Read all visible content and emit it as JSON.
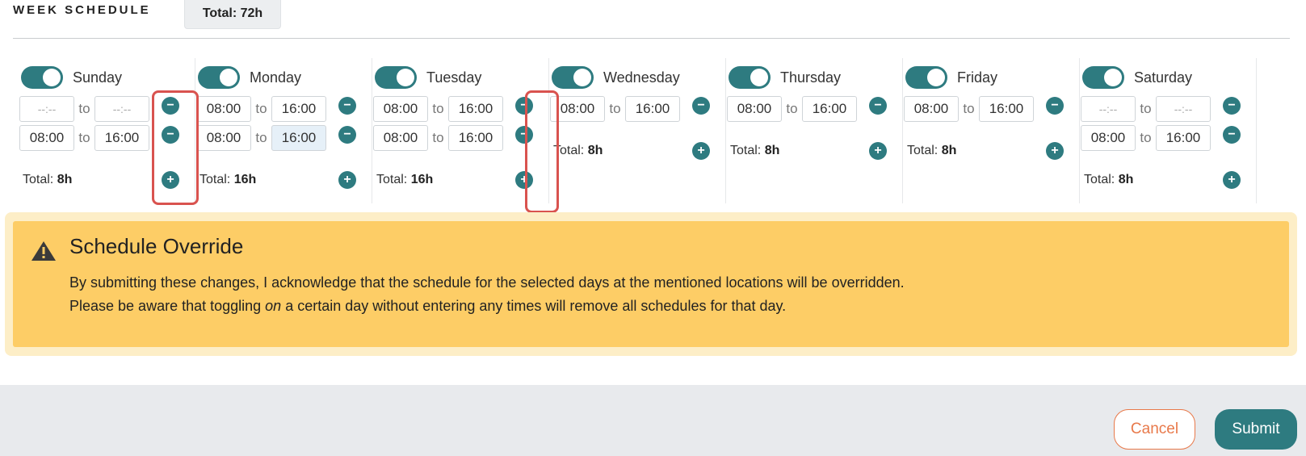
{
  "header": {
    "title": "WEEK SCHEDULE",
    "total": "Total: 72h"
  },
  "days": [
    {
      "name": "Sunday",
      "enabled": true,
      "slots": [
        {
          "from": "--:--",
          "to": "--:--"
        },
        {
          "from": "08:00",
          "to": "16:00"
        }
      ],
      "total_label": "Total:",
      "total_value": "8h"
    },
    {
      "name": "Monday",
      "enabled": true,
      "slots": [
        {
          "from": "08:00",
          "to": "16:00"
        },
        {
          "from": "08:00",
          "to": "16:00"
        }
      ],
      "total_label": "Total:",
      "total_value": "16h"
    },
    {
      "name": "Tuesday",
      "enabled": true,
      "slots": [
        {
          "from": "08:00",
          "to": "16:00"
        },
        {
          "from": "08:00",
          "to": "16:00"
        }
      ],
      "total_label": "Total:",
      "total_value": "16h"
    },
    {
      "name": "Wednesday",
      "enabled": true,
      "slots": [
        {
          "from": "08:00",
          "to": "16:00"
        }
      ],
      "total_label": "Total:",
      "total_value": "8h"
    },
    {
      "name": "Thursday",
      "enabled": true,
      "slots": [
        {
          "from": "08:00",
          "to": "16:00"
        }
      ],
      "total_label": "Total:",
      "total_value": "8h"
    },
    {
      "name": "Friday",
      "enabled": true,
      "slots": [
        {
          "from": "08:00",
          "to": "16:00"
        }
      ],
      "total_label": "Total:",
      "total_value": "8h"
    },
    {
      "name": "Saturday",
      "enabled": true,
      "slots": [
        {
          "from": "--:--",
          "to": "--:--"
        },
        {
          "from": "08:00",
          "to": "16:00"
        }
      ],
      "total_label": "Total:",
      "total_value": "8h"
    }
  ],
  "slot_separator": "to",
  "alert": {
    "title": "Schedule Override",
    "line1": "By submitting these changes, I acknowledge that the schedule for the selected days at the mentioned locations will be overridden.",
    "line2_before": "Please be aware that toggling ",
    "line2_emphasis": "on",
    "line2_after": " a certain day without entering any times will remove all schedules for that day."
  },
  "footer": {
    "cancel_label": "Cancel",
    "submit_label": "Submit"
  },
  "colors": {
    "accent": "#2e7b80",
    "warning_bg": "#fdcd66",
    "cancel": "#e8794a",
    "highlight": "#d9534f"
  }
}
